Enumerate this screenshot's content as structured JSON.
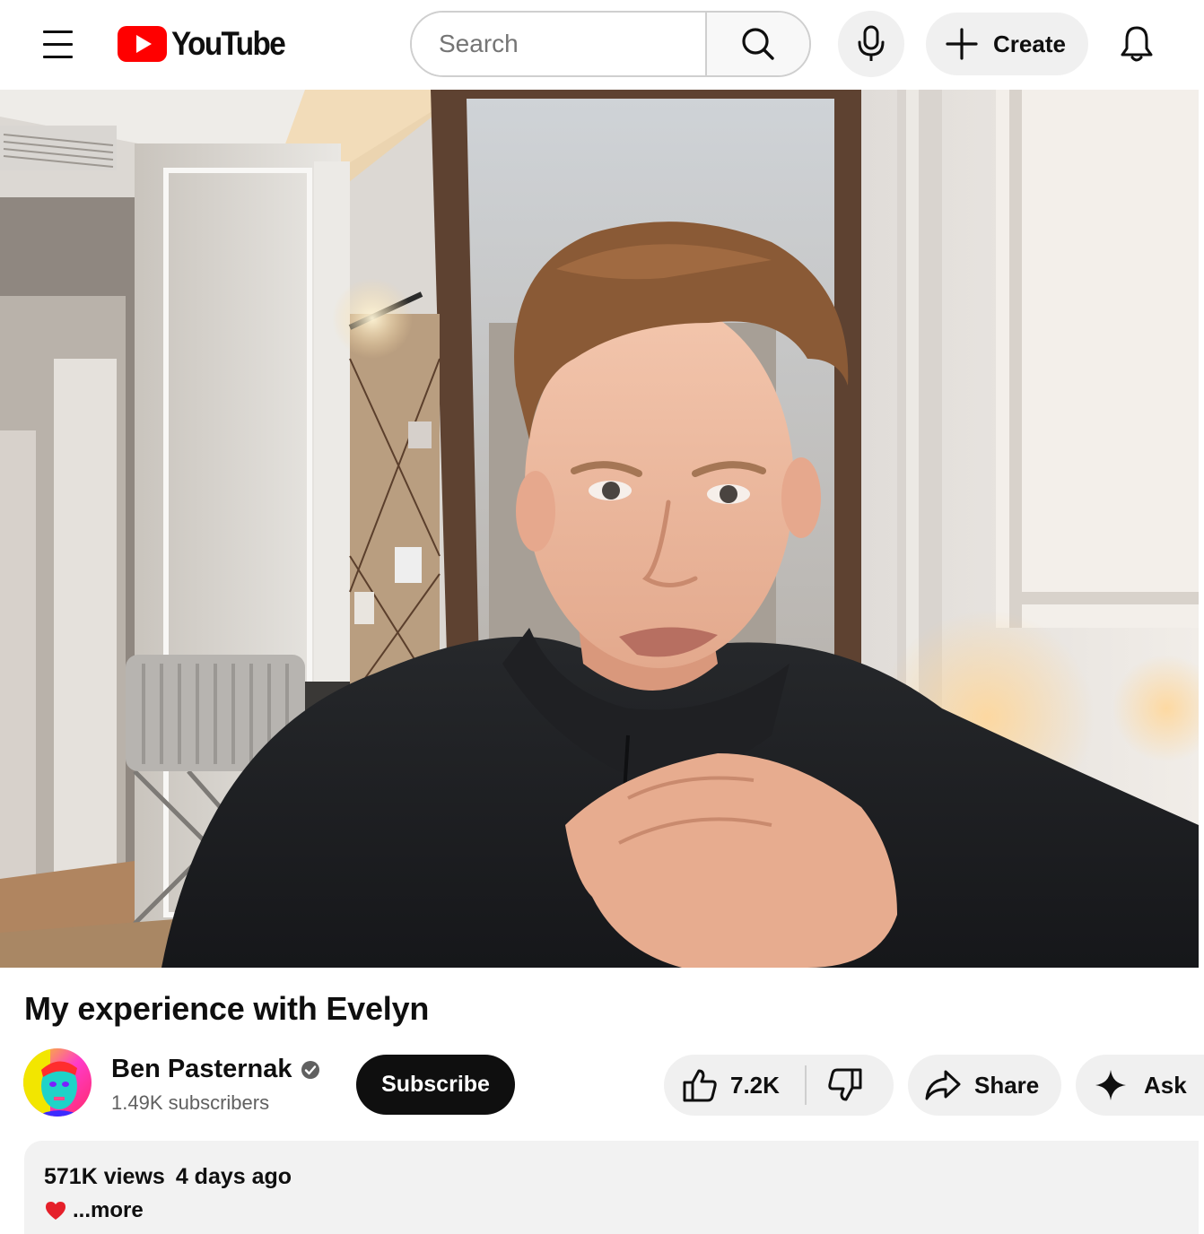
{
  "header": {
    "logo_text": "YouTube",
    "search_placeholder": "Search",
    "create_label": "Create"
  },
  "video": {
    "title": "My experience with Evelyn",
    "channel": {
      "name": "Ben Pasternak",
      "subscribers": "1.49K subscribers",
      "verified": true
    },
    "subscribe_label": "Subscribe",
    "actions": {
      "like_count": "7.2K",
      "share_label": "Share",
      "ask_label": "Ask"
    },
    "description": {
      "views": "571K views",
      "age": "4 days ago",
      "more_label": "...more"
    }
  },
  "icons": {
    "menu": "hamburger-icon",
    "search": "search-icon",
    "mic": "microphone-icon",
    "create": "plus-icon",
    "notifications": "bell-icon",
    "like": "thumbs-up-icon",
    "dislike": "thumbs-down-icon",
    "share": "share-arrow-icon",
    "ask": "sparkle-icon",
    "description_emoji": "red-heart-icon"
  },
  "colors": {
    "brand_red": "#ff0000",
    "subscribe_bg": "#0f0f0f",
    "pill_bg": "#f0f0f0"
  }
}
